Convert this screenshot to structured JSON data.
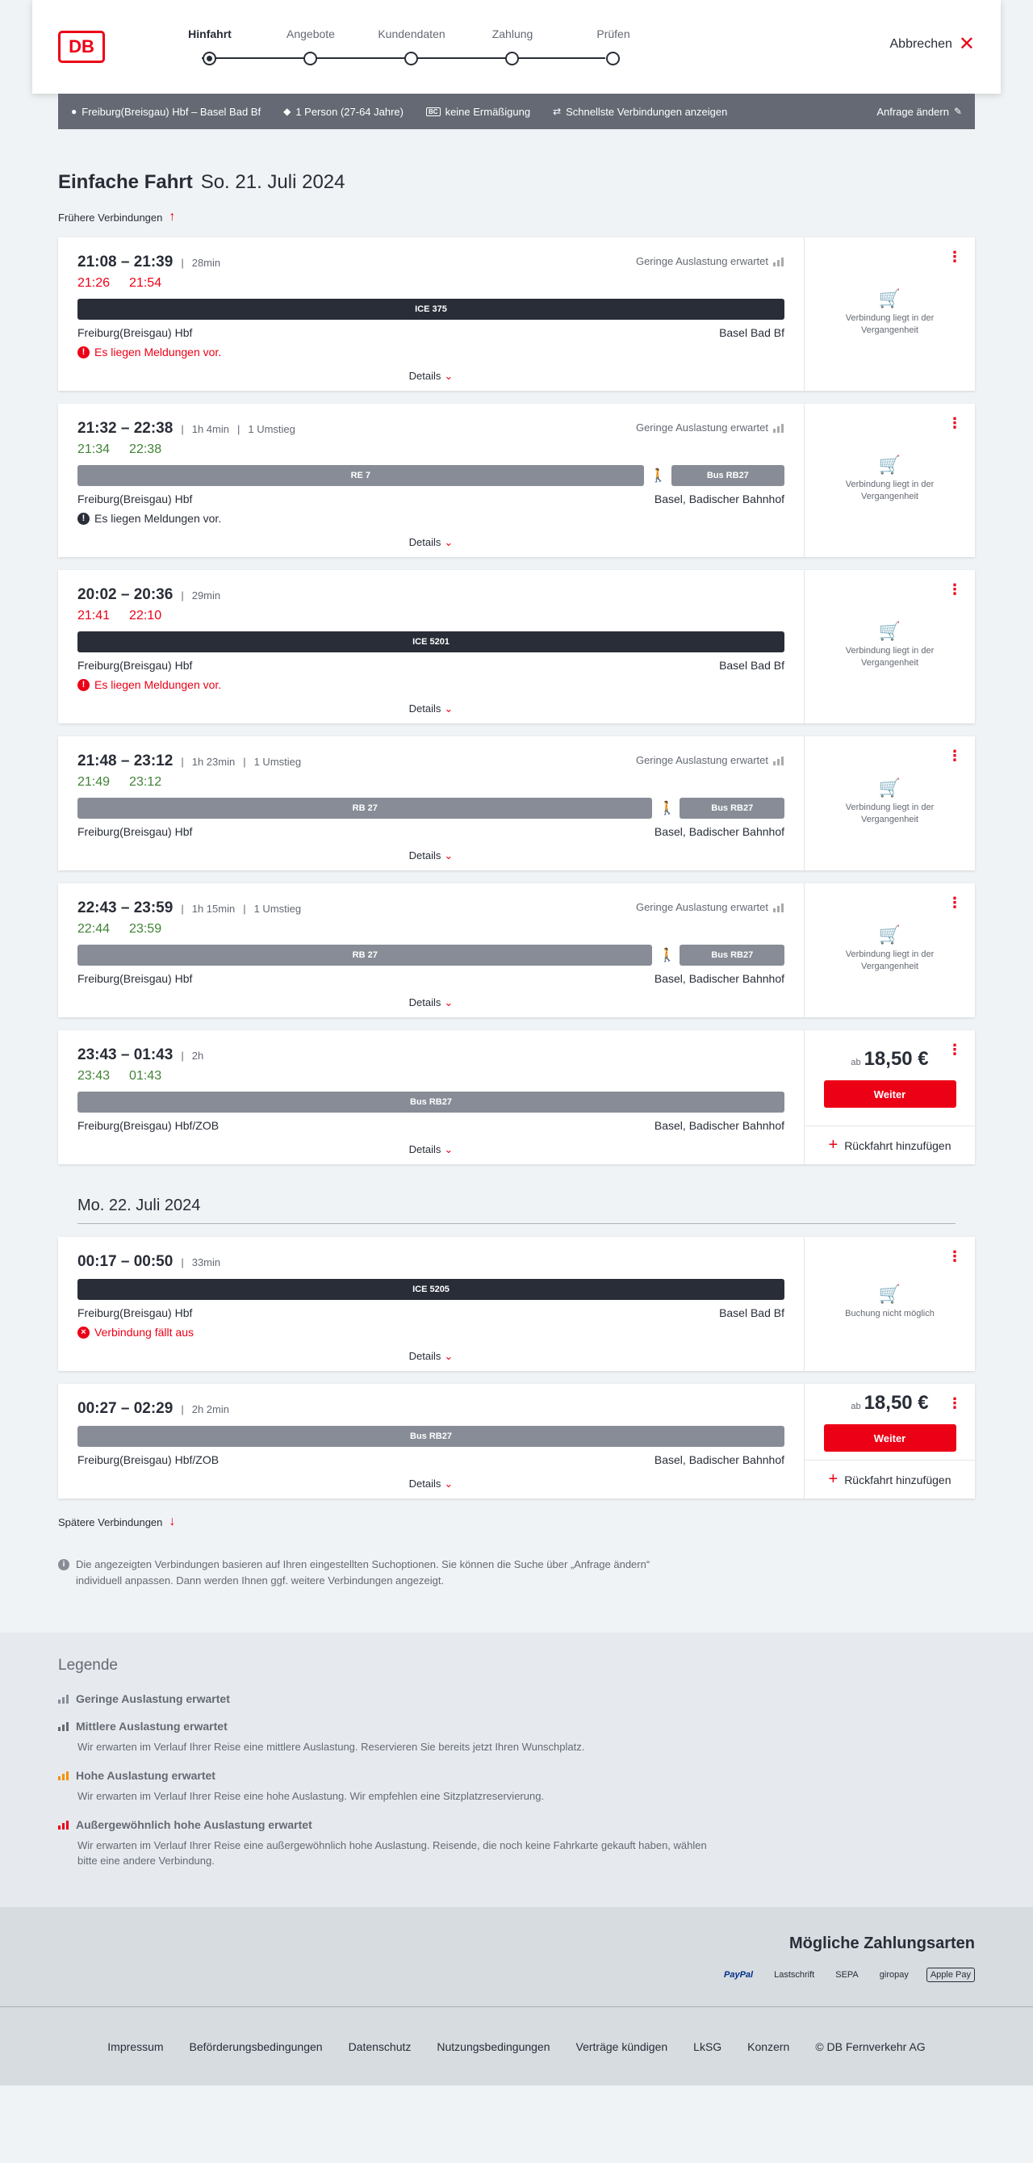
{
  "header": {
    "logo": "DB",
    "steps": [
      "Hinfahrt",
      "Angebote",
      "Kundendaten",
      "Zahlung",
      "Prüfen"
    ],
    "cancel_label": "Abbrechen"
  },
  "searchbar": {
    "route": "Freiburg(Breisgau) Hbf – Basel Bad Bf",
    "persons": "1 Person (27-64 Jahre)",
    "bc_badge": "BC",
    "discount": "keine Ermäßigung",
    "fastest": "Schnellste Verbindungen anzeigen",
    "change": "Anfrage ändern"
  },
  "page": {
    "title": "Einfache Fahrt",
    "date": "So. 21. Juli 2024",
    "earlier": "Frühere Verbindungen",
    "later": "Spätere Verbindungen",
    "day2": "Mo. 22. Juli 2024",
    "info": "Die angezeigten Verbindungen basieren auf Ihren eingestellten Suchoptionen. Sie können die Suche über „Anfrage ändern“ individuell anpassen. Dann werden Ihnen ggf. weitere Verbindungen angezeigt.",
    "details": "Details",
    "past_text": "Verbindung liegt in der Vergangenheit",
    "no_booking": "Buchung nicht möglich",
    "price_prefix": "ab",
    "weiter": "Weiter",
    "return_add": "Rückfahrt hinzufügen"
  },
  "connections": [
    {
      "time": "21:08 – 21:39",
      "duration": "28min",
      "changes": "",
      "load": "Geringe Auslastung erwartet",
      "rt_dep": "21:26",
      "rt_arr": "21:54",
      "rt_status": "late",
      "segments": [
        {
          "label": "ICE 375",
          "style": "dark",
          "flex": 1
        }
      ],
      "from": "Freiburg(Breisgau) Hbf",
      "to": "Basel Bad Bf",
      "message": "Es liegen Meldungen vor.",
      "msg_style": "red",
      "status": "past",
      "price": ""
    },
    {
      "time": "21:32 – 22:38",
      "duration": "1h 4min",
      "changes": "1 Umstieg",
      "load": "Geringe Auslastung erwartet",
      "rt_dep": "21:34",
      "rt_arr": "22:38",
      "rt_status": "ontime",
      "segments": [
        {
          "label": "RE 7",
          "style": "grey",
          "flex": 5
        },
        {
          "label": "walk"
        },
        {
          "label": "Bus RB27",
          "style": "grey",
          "flex": 1
        }
      ],
      "from": "Freiburg(Breisgau) Hbf",
      "to": "Basel, Badischer Bahnhof",
      "message": "Es liegen Meldungen vor.",
      "msg_style": "black",
      "status": "past",
      "price": ""
    },
    {
      "time": "20:02 – 20:36",
      "duration": "29min",
      "changes": "",
      "load": "",
      "rt_dep": "21:41",
      "rt_arr": "22:10",
      "rt_status": "late",
      "segments": [
        {
          "label": "ICE 5201",
          "style": "dark",
          "flex": 1
        }
      ],
      "from": "Freiburg(Breisgau) Hbf",
      "to": "Basel Bad Bf",
      "message": "Es liegen Meldungen vor.",
      "msg_style": "red",
      "status": "past",
      "price": ""
    },
    {
      "time": "21:48 – 23:12",
      "duration": "1h 23min",
      "changes": "1 Umstieg",
      "load": "Geringe Auslastung erwartet",
      "rt_dep": "21:49",
      "rt_arr": "23:12",
      "rt_status": "ontime",
      "segments": [
        {
          "label": "RB 27",
          "style": "grey",
          "flex": 5.5
        },
        {
          "label": "walk"
        },
        {
          "label": "Bus RB27",
          "style": "grey",
          "flex": 1
        }
      ],
      "from": "Freiburg(Breisgau) Hbf",
      "to": "Basel, Badischer Bahnhof",
      "message": "",
      "msg_style": "",
      "status": "past",
      "price": ""
    },
    {
      "time": "22:43 – 23:59",
      "duration": "1h 15min",
      "changes": "1 Umstieg",
      "load": "Geringe Auslastung erwartet",
      "rt_dep": "22:44",
      "rt_arr": "23:59",
      "rt_status": "ontime",
      "segments": [
        {
          "label": "RB 27",
          "style": "grey",
          "flex": 5.5
        },
        {
          "label": "walk"
        },
        {
          "label": "Bus RB27",
          "style": "grey",
          "flex": 1
        }
      ],
      "from": "Freiburg(Breisgau) Hbf",
      "to": "Basel, Badischer Bahnhof",
      "message": "",
      "msg_style": "",
      "status": "past",
      "price": ""
    },
    {
      "time": "23:43 – 01:43",
      "duration": "2h",
      "changes": "",
      "load": "",
      "rt_dep": "23:43",
      "rt_arr": "01:43",
      "rt_status": "ontime",
      "segments": [
        {
          "label": "Bus RB27",
          "style": "grey",
          "flex": 1
        }
      ],
      "from": "Freiburg(Breisgau) Hbf/ZOB",
      "to": "Basel, Badischer Bahnhof",
      "message": "",
      "msg_style": "",
      "status": "price",
      "price": "18,50 €"
    }
  ],
  "connections_day2": [
    {
      "time": "00:17 – 00:50",
      "duration": "33min",
      "changes": "",
      "load": "",
      "rt_dep": "",
      "rt_arr": "",
      "rt_status": "",
      "segments": [
        {
          "label": "ICE 5205",
          "style": "dark",
          "flex": 1
        }
      ],
      "from": "Freiburg(Breisgau) Hbf",
      "to": "Basel Bad Bf",
      "message": "Verbindung fällt aus",
      "msg_style": "red-x",
      "status": "nobook",
      "price": ""
    },
    {
      "time": "00:27 – 02:29",
      "duration": "2h 2min",
      "changes": "",
      "load": "",
      "rt_dep": "",
      "rt_arr": "",
      "rt_status": "",
      "segments": [
        {
          "label": "Bus RB27",
          "style": "grey",
          "flex": 1
        }
      ],
      "from": "Freiburg(Breisgau) Hbf/ZOB",
      "to": "Basel, Badischer Bahnhof",
      "message": "",
      "msg_style": "",
      "status": "price",
      "price": "18,50 €"
    }
  ],
  "legend": {
    "title": "Legende",
    "items": [
      {
        "title": "Geringe Auslastung erwartet",
        "desc": "",
        "color": "#878c96"
      },
      {
        "title": "Mittlere Auslastung erwartet",
        "desc": "Wir erwarten im Verlauf Ihrer Reise eine mittlere Auslastung. Reservieren Sie bereits jetzt Ihren Wunschplatz.",
        "color": "#646973"
      },
      {
        "title": "Hohe Auslastung erwartet",
        "desc": "Wir erwarten im Verlauf Ihrer Reise eine hohe Auslastung. Wir empfehlen eine Sitzplatzreservierung.",
        "color": "#f39200"
      },
      {
        "title": "Außergewöhnlich hohe Auslastung erwartet",
        "desc": "Wir erwarten im Verlauf Ihrer Reise eine außergewöhnlich hohe Auslastung. Reisende, die noch keine Fahrkarte gekauft haben, wählen bitte eine andere Verbindung.",
        "color": "#ec0016"
      }
    ]
  },
  "payment": {
    "title": "Mögliche Zahlungsarten",
    "methods": [
      "PayPal",
      "Lastschrift",
      "SEPA",
      "giropay",
      "Apple Pay"
    ]
  },
  "footer": [
    "Impressum",
    "Beförderungsbedingungen",
    "Datenschutz",
    "Nutzungsbedingungen",
    "Verträge kündigen",
    "LkSG",
    "Konzern",
    "© DB Fernverkehr AG"
  ]
}
